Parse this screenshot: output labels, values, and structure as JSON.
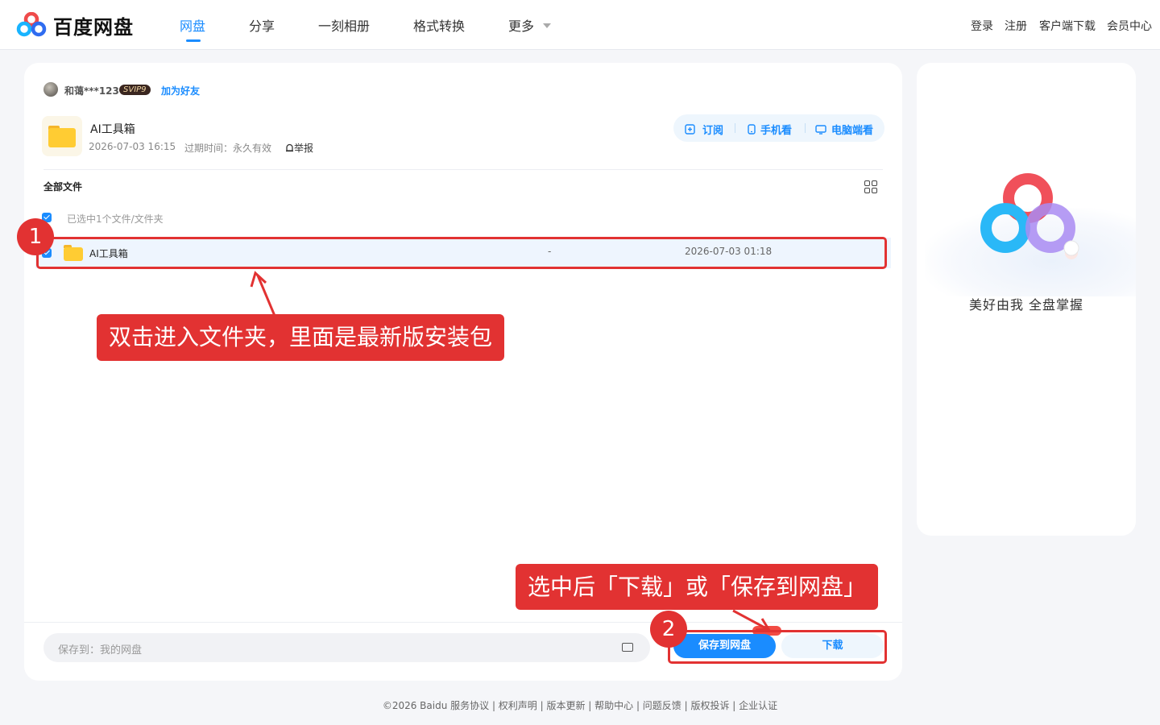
{
  "header": {
    "logo_text": "百度网盘",
    "nav": [
      {
        "label": "网盘",
        "active": true
      },
      {
        "label": "分享",
        "active": false
      },
      {
        "label": "一刻相册",
        "active": false
      },
      {
        "label": "格式转换",
        "active": false
      },
      {
        "label": "更多",
        "active": false
      }
    ],
    "right_links": [
      "登录",
      "注册",
      "客户端下载",
      "会员中心"
    ]
  },
  "share": {
    "username": "和蔼***123",
    "vip_badge": "SVIP9",
    "add_friend": "加为好友",
    "title": "AI工具箱",
    "created": "2026-07-03 16:15",
    "expire_label": "过期时间：永久有效",
    "report": "举报",
    "actions": [
      "订阅",
      "手机看",
      "电脑端看"
    ]
  },
  "files": {
    "section_title": "全部文件",
    "selected_info": "已选中1个文件/文件夹",
    "rows": [
      {
        "name": "AI工具箱",
        "size": "-",
        "date": "2026-07-03 01:18",
        "checked": true
      }
    ]
  },
  "bottom": {
    "save_to_placeholder": "保存到：我的网盘",
    "save_button": "保存到网盘",
    "download_button": "下载"
  },
  "side": {
    "slogan": "美好由我  全盘掌握"
  },
  "annotations": {
    "badge1": "1",
    "badge2": "2",
    "callout1": "双击进入文件夹，里面是最新版安装包",
    "callout2": "选中后「下载」或「保存到网盘」"
  },
  "footer": "©2026 Baidu  服务协议 | 权利声明 | 版本更新 | 帮助中心 | 问题反馈 | 版权投诉 | 企业认证",
  "colors": {
    "accent": "#1a8cff",
    "annotation_red": "#e23232",
    "folder_yellow": "#ffcc33"
  }
}
